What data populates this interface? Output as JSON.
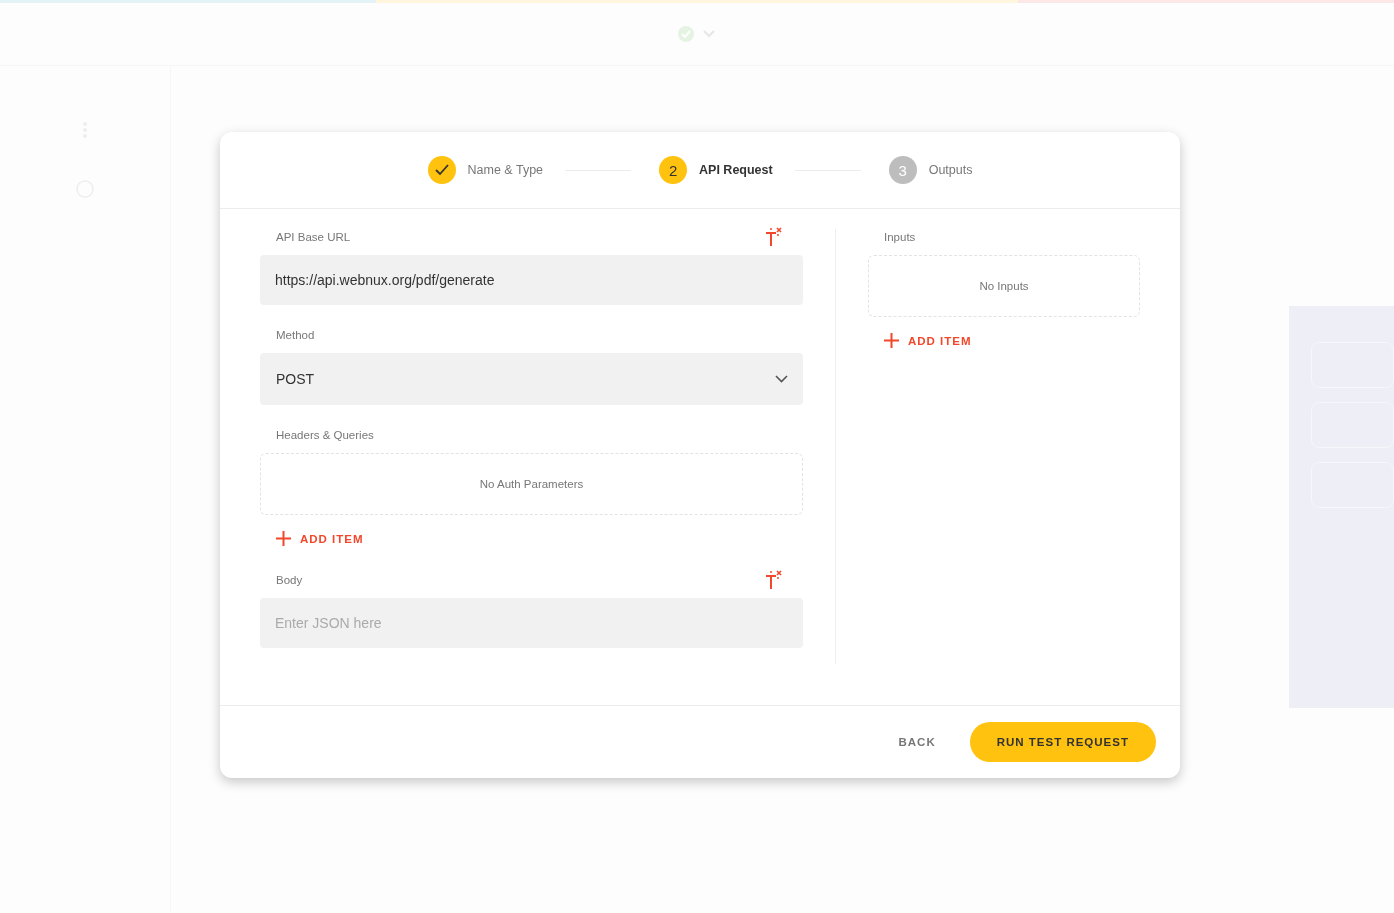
{
  "steps": [
    {
      "label": "Name & Type",
      "completed": true,
      "selected": false
    },
    {
      "number": "2",
      "label": "API Request",
      "completed": false,
      "selected": true
    },
    {
      "number": "3",
      "label": "Outputs",
      "completed": false,
      "selected": false
    }
  ],
  "request": [
    {
      "kind": "text",
      "label": "API Base URL",
      "value": "https://api.webnux.org/pdf/generate",
      "magic": true
    },
    {
      "kind": "select",
      "label": "Method",
      "value": "POST"
    },
    {
      "kind": "list",
      "label": "Headers & Queries",
      "empty_text": "No Auth Parameters",
      "add_label": "ADD ITEM"
    },
    {
      "kind": "text",
      "label": "Body",
      "placeholder": "Enter JSON here",
      "magic": true
    }
  ],
  "inputs": {
    "label": "Inputs",
    "empty_text": "No Inputs",
    "add_label": "ADD ITEM"
  },
  "footer": {
    "back": "BACK",
    "run": "RUN TEST REQUEST"
  }
}
